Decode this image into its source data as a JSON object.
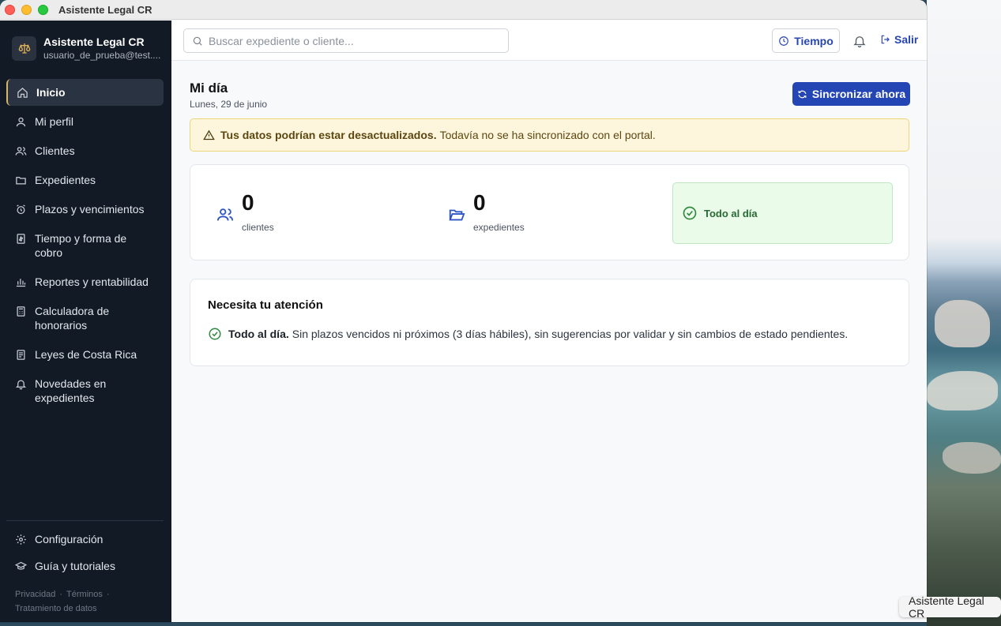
{
  "window": {
    "title": "Asistente Legal CR"
  },
  "sidebar": {
    "brand_name": "Asistente Legal CR",
    "brand_user": "usuario_de_prueba@test....",
    "items": [
      {
        "label": "Inicio",
        "icon": "home-icon",
        "active": true
      },
      {
        "label": "Mi perfil",
        "icon": "user-icon"
      },
      {
        "label": "Clientes",
        "icon": "users-icon"
      },
      {
        "label": "Expedientes",
        "icon": "folder-icon"
      },
      {
        "label": "Plazos y vencimientos",
        "icon": "alarm-clock-icon"
      },
      {
        "label": "Tiempo y forma de cobro",
        "icon": "receipt-icon"
      },
      {
        "label": "Reportes y rentabilidad",
        "icon": "bar-chart-icon"
      },
      {
        "label": "Calculadora de honorarios",
        "icon": "calculator-icon"
      },
      {
        "label": "Leyes de Costa Rica",
        "icon": "document-icon"
      },
      {
        "label": "Novedades en expedientes",
        "icon": "bell-icon"
      }
    ],
    "bottom_items": [
      {
        "label": "Configuración",
        "icon": "gear-icon"
      },
      {
        "label": "Guía y tutoriales",
        "icon": "graduation-cap-icon"
      }
    ],
    "legal": {
      "privacy": "Privacidad",
      "terms": "Términos",
      "data": "Tratamiento de datos"
    }
  },
  "topbar": {
    "search_placeholder": "Buscar expediente o cliente...",
    "tiempo_label": "Tiempo",
    "salir_label": "Salir"
  },
  "main": {
    "title": "Mi día",
    "date": "Lunes, 29 de junio",
    "sync_label": "Sincronizar ahora",
    "alert": {
      "bold": "Tus datos podrían estar desactualizados.",
      "text": "Todavía no se ha sincronizado con el portal."
    },
    "stats": {
      "clients_count": "0",
      "clients_label": "clientes",
      "cases_count": "0",
      "cases_label": "expedientes",
      "status": "Todo al día"
    },
    "attention": {
      "title": "Necesita tu atención",
      "bold": "Todo al día.",
      "text": "Sin plazos vencidos ni próximos (3 días hábiles), sin sugerencias por validar y sin cambios de estado pendientes."
    }
  },
  "dock": {
    "tooltip": "Asistente Legal CR"
  },
  "colors": {
    "sidebar_bg": "#121a26",
    "accent": "#2446b4",
    "success": "#2f8a3e",
    "warning_bg": "#fdf6dc"
  }
}
